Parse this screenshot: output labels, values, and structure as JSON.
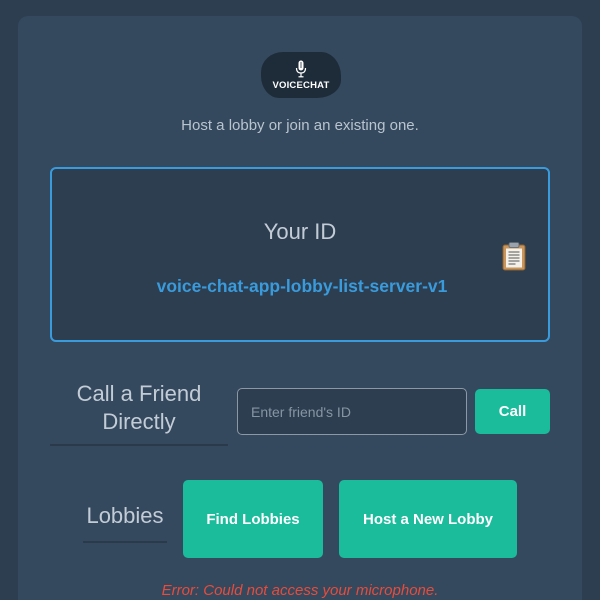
{
  "logo": {
    "text": "VOICECHAT",
    "icon": "microphone-icon"
  },
  "tagline": "Host a lobby or join an existing one.",
  "id_panel": {
    "title": "Your ID",
    "value": "voice-chat-app-lobby-list-server-v1",
    "copy_icon": "clipboard-icon"
  },
  "call": {
    "label_line1": "Call a Friend",
    "label_line2": "Directly",
    "input_placeholder": "Enter friend's ID",
    "button_label": "Call"
  },
  "lobbies": {
    "label": "Lobbies",
    "find_button": "Find Lobbies",
    "host_button": "Host a New Lobby"
  },
  "error_message": "Error: Could not access your microphone.",
  "colors": {
    "background": "#2c3e50",
    "card": "#34495e",
    "accent": "#1abc9c",
    "id_blue": "#3a9bdc",
    "error": "#e74c3c"
  }
}
